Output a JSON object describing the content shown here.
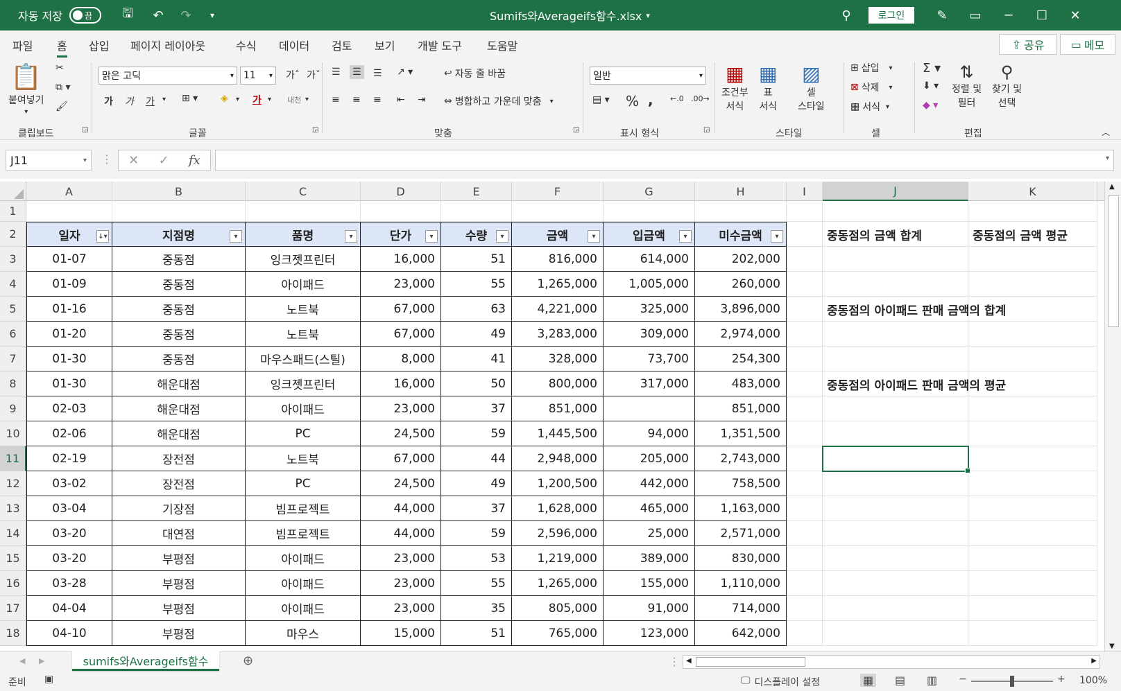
{
  "titlebar": {
    "autosave_label": "자동 저장",
    "autosave_state": "끔",
    "filename": "Sumifs와Averageifs함수.xlsx",
    "login_label": "로그인"
  },
  "menu": {
    "tabs": [
      "파일",
      "홈",
      "삽입",
      "페이지 레이아웃",
      "수식",
      "데이터",
      "검토",
      "보기",
      "개발 도구",
      "도움말"
    ],
    "active": "홈",
    "share_label": "공유",
    "memo_label": "메모"
  },
  "ribbon": {
    "clipboard": {
      "paste_label": "붙여넣기",
      "group": "클립보드"
    },
    "font": {
      "name": "맑은 고딕",
      "size": "11",
      "group": "글꼴",
      "bold": "가",
      "italic": "가",
      "underline": "가",
      "phonetic": "내천"
    },
    "align": {
      "wrap_label": "자동 줄 바꿈",
      "merge_label": "병합하고 가운데 맞춤",
      "group": "맞춤"
    },
    "number": {
      "format": "일반",
      "group": "표시 형식"
    },
    "styles": {
      "cond_label_1": "조건부",
      "cond_label_2": "서식",
      "table_label_1": "표",
      "table_label_2": "서식",
      "cell_label_1": "셀",
      "cell_label_2": "스타일",
      "group": "스타일"
    },
    "cells": {
      "insert_label": "삽입",
      "delete_label": "삭제",
      "format_label": "서식",
      "group": "셀"
    },
    "edit": {
      "sort_label_1": "정렬 및",
      "sort_label_2": "필터",
      "find_label_1": "찾기 및",
      "find_label_2": "선택",
      "group": "편집"
    }
  },
  "formula_bar": {
    "name_box": "J11",
    "formula": ""
  },
  "sheet": {
    "columns": [
      "A",
      "B",
      "C",
      "D",
      "E",
      "F",
      "G",
      "H",
      "I",
      "J",
      "K"
    ],
    "selected_column": "J",
    "selected_row": "11",
    "row_numbers": [
      "1",
      "2",
      "3",
      "4",
      "5",
      "6",
      "7",
      "8",
      "9",
      "10",
      "11",
      "12",
      "13",
      "14",
      "15",
      "16",
      "17",
      "18"
    ],
    "headers": [
      "일자",
      "지점명",
      "품명",
      "단가",
      "수량",
      "금액",
      "입금액",
      "미수금액"
    ],
    "rows": [
      [
        "01-07",
        "중동점",
        "잉크젯프린터",
        "16,000",
        "51",
        "816,000",
        "614,000",
        "202,000"
      ],
      [
        "01-09",
        "중동점",
        "아이패드",
        "23,000",
        "55",
        "1,265,000",
        "1,005,000",
        "260,000"
      ],
      [
        "01-16",
        "중동점",
        "노트북",
        "67,000",
        "63",
        "4,221,000",
        "325,000",
        "3,896,000"
      ],
      [
        "01-20",
        "중동점",
        "노트북",
        "67,000",
        "49",
        "3,283,000",
        "309,000",
        "2,974,000"
      ],
      [
        "01-30",
        "중동점",
        "마우스패드(스틸)",
        "8,000",
        "41",
        "328,000",
        "73,700",
        "254,300"
      ],
      [
        "01-30",
        "해운대점",
        "잉크젯프린터",
        "16,000",
        "50",
        "800,000",
        "317,000",
        "483,000"
      ],
      [
        "02-03",
        "해운대점",
        "아이패드",
        "23,000",
        "37",
        "851,000",
        "",
        "851,000"
      ],
      [
        "02-06",
        "해운대점",
        "PC",
        "24,500",
        "59",
        "1,445,500",
        "94,000",
        "1,351,500"
      ],
      [
        "02-19",
        "장전점",
        "노트북",
        "67,000",
        "44",
        "2,948,000",
        "205,000",
        "2,743,000"
      ],
      [
        "03-02",
        "장전점",
        "PC",
        "24,500",
        "49",
        "1,200,500",
        "442,000",
        "758,500"
      ],
      [
        "03-04",
        "기장점",
        "빔프로젝트",
        "44,000",
        "37",
        "1,628,000",
        "465,000",
        "1,163,000"
      ],
      [
        "03-20",
        "대연점",
        "빔프로젝트",
        "44,000",
        "59",
        "2,596,000",
        "25,000",
        "2,571,000"
      ],
      [
        "03-20",
        "부평점",
        "아이패드",
        "23,000",
        "53",
        "1,219,000",
        "389,000",
        "830,000"
      ],
      [
        "03-28",
        "부평점",
        "아이패드",
        "23,000",
        "55",
        "1,265,000",
        "155,000",
        "1,110,000"
      ],
      [
        "04-04",
        "부평점",
        "아이패드",
        "23,000",
        "35",
        "805,000",
        "91,000",
        "714,000"
      ],
      [
        "04-10",
        "부평점",
        "마우스",
        "15,000",
        "51",
        "765,000",
        "123,000",
        "642,000"
      ]
    ],
    "labels": {
      "j2": "중동점의 금액 합계",
      "k2": "중동점의 금액 평균",
      "j5": "중동점의 아이패드 판매 금액의 합계",
      "j8": "중동점의 아이패드 판매 금액의 평균"
    }
  },
  "sheet_tabs": {
    "active": "sumifs와Averageifs함수"
  },
  "status": {
    "ready": "준비",
    "display_settings": "디스플레이 설정",
    "zoom": "100%"
  }
}
